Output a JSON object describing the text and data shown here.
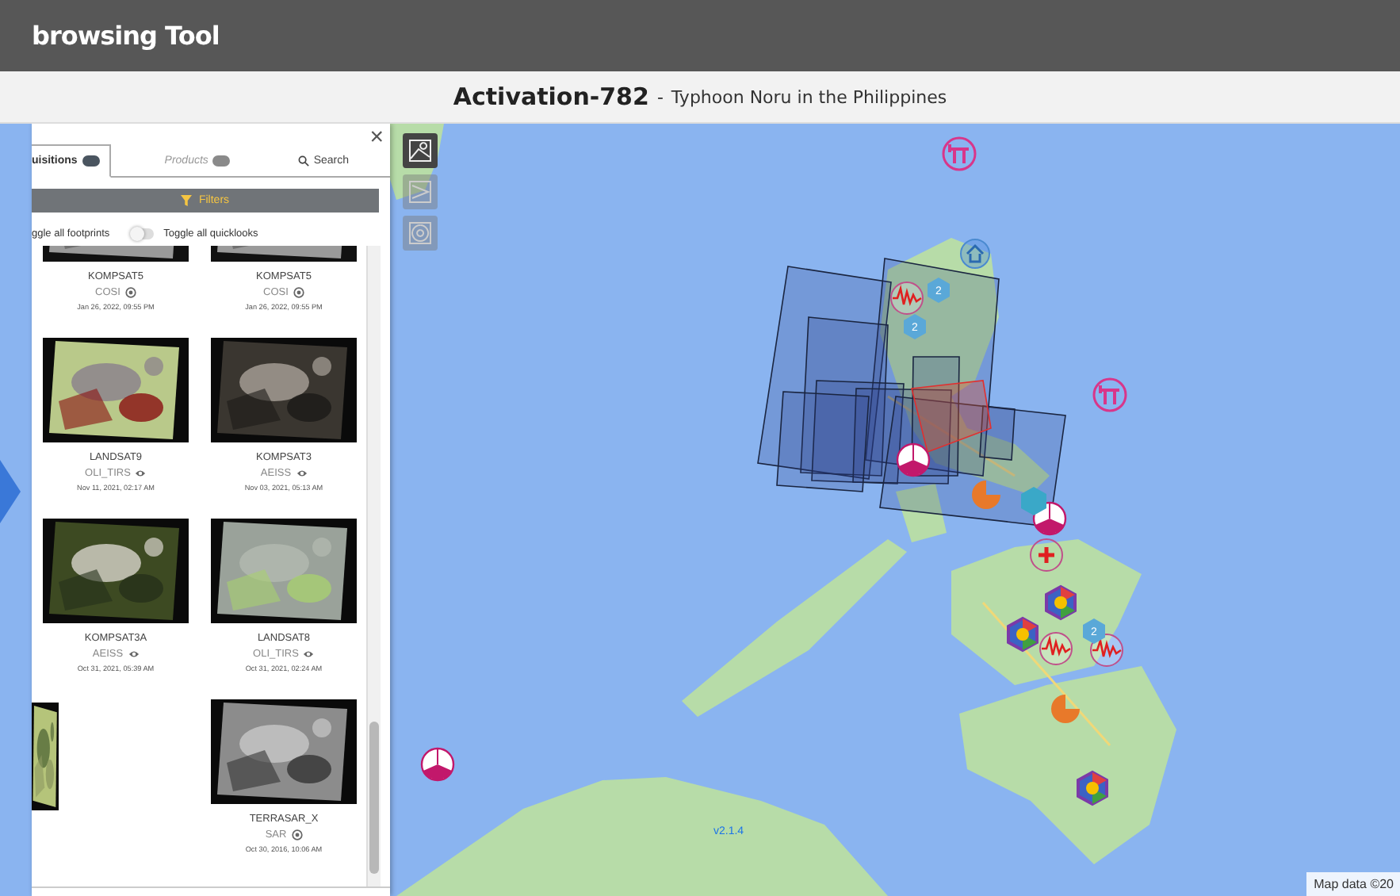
{
  "header": {
    "title": "browsing Tool"
  },
  "title_bar": {
    "activation": "Activation-782",
    "separator": "-",
    "event": "Typhoon Noru in the Philippines"
  },
  "panel": {
    "close": "×",
    "tabs": [
      {
        "label": "uisitions",
        "selected": true
      },
      {
        "label": "Products",
        "selected": false
      },
      {
        "label": "Search",
        "selected": false
      }
    ],
    "filters": "Filters",
    "toggles": [
      {
        "label": "ggle all footprints"
      },
      {
        "label": "Toggle all quicklooks",
        "on": false
      }
    ],
    "acquisitions": [
      {
        "name": "KOMPSAT5",
        "sensor": "COSI",
        "quicklook": false,
        "date": "Jan 26, 2022, 09:55 PM"
      },
      {
        "name": "KOMPSAT5",
        "sensor": "COSI",
        "quicklook": false,
        "date": "Jan 26, 2022, 09:55 PM"
      },
      {
        "name": "LANDSAT9",
        "sensor": "OLI_TIRS",
        "quicklook": true,
        "date": "Nov 11, 2021, 02:17 AM"
      },
      {
        "name": "KOMPSAT3",
        "sensor": "AEISS",
        "quicklook": true,
        "date": "Nov 03, 2021, 05:13 AM"
      },
      {
        "name": "KOMPSAT3A",
        "sensor": "AEISS",
        "quicklook": true,
        "date": "Oct 31, 2021, 05:39 AM"
      },
      {
        "name": "LANDSAT8",
        "sensor": "OLI_TIRS",
        "quicklook": true,
        "date": "Oct 31, 2021, 02:24 AM"
      },
      {
        "kind": "picture"
      },
      {
        "name": "TERRASAR_X",
        "sensor": "SAR",
        "quicklook": false,
        "date": "Oct 30, 2016, 10:06 AM"
      }
    ]
  },
  "map": {
    "controls": [
      {
        "selected": true
      },
      {
        "selected": false
      },
      {
        "selected": false
      }
    ],
    "clusters": [
      {
        "label": "2"
      },
      {
        "label": "2"
      },
      {
        "label": "2"
      }
    ],
    "version": "v2.1.4",
    "attribution": "Map data ©20"
  }
}
